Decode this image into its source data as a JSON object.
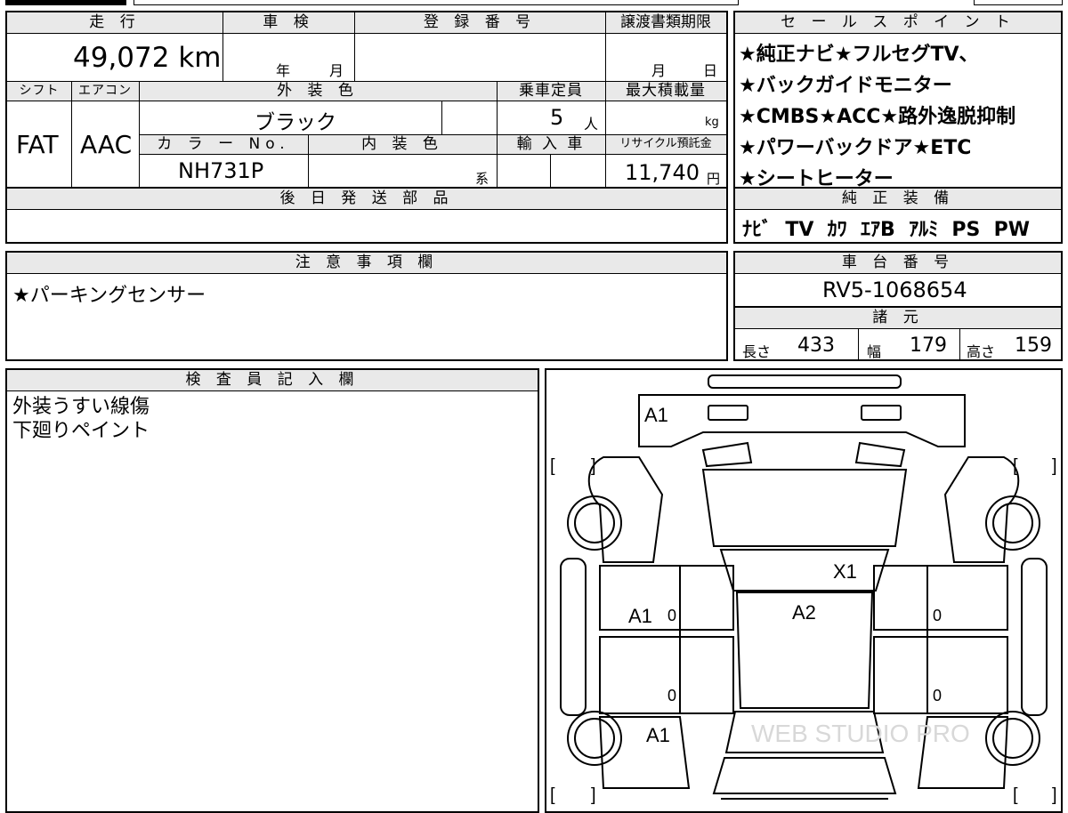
{
  "top_tab": {
    "label": ""
  },
  "vehicle": {
    "mileage_label": "走 行",
    "mileage": "49,072 km",
    "inspection_label": "車 検",
    "inspection_year": "年",
    "inspection_month": "月",
    "registration_label": "登 録 番 号",
    "registration": "",
    "transfer_label": "譲渡書類期限",
    "transfer_month": "月",
    "transfer_day": "日",
    "shift_label": "シフト",
    "shift": "FAT",
    "ac_label": "エアコン",
    "ac": "AAC",
    "exterior_label": "外 装 色",
    "exterior_color": "ブラック",
    "color_no_label": "カ ラ ー No.",
    "color_no": "NH731P",
    "interior_label": "内 装 色",
    "interior_suffix": "系",
    "capacity_label": "乗車定員",
    "capacity": "5",
    "capacity_unit": "人",
    "max_load_label": "最大積載量",
    "max_load_unit": "kg",
    "import_label": "輸 入 車",
    "recycle_label": "リサイクル預託金",
    "recycle_fee": "11,740",
    "recycle_unit": "円"
  },
  "later_parts": {
    "label": "後 日 発 送 部 品",
    "value": ""
  },
  "sales_points": {
    "label": "セ ー ル ス ポ イ ン ト",
    "items": [
      "★純正ナビ★フルセグTV、",
      "★バックガイドモニター",
      "★CMBS★ACC★路外逸脱抑制",
      "★パワーバックドア★ETC",
      "★シートヒーター"
    ]
  },
  "equipment": {
    "label": "純 正 装 備",
    "items": "ﾅﾋﾞ  TV  ｶﾜ  ｴｱB  ｱﾙﾐ  PS  PW"
  },
  "caution": {
    "label": "注 意 事 項 欄",
    "text": "★パーキングセンサー"
  },
  "chassis": {
    "label": "車 台 番 号",
    "number": "RV5-1068654"
  },
  "specs": {
    "label": "諸 元",
    "length_label": "長さ",
    "length": "433",
    "width_label": "幅",
    "width": "179",
    "height_label": "高さ",
    "height": "159"
  },
  "inspector": {
    "label": "検 査 員 記 入 欄",
    "lines": [
      "外装うすい線傷",
      "下廻りペイント"
    ]
  },
  "diagram": {
    "marks": {
      "front_bumper": "A1",
      "hood": "X1",
      "roof": "A2",
      "left_front_door": "A1",
      "left_rear": "A1",
      "zero_1": "0",
      "zero_2": "0",
      "zero_3": "0",
      "zero_4": "0",
      "bracket_open": "[",
      "bracket_close": "]"
    },
    "watermark": "WEB STUDIO PRO"
  }
}
